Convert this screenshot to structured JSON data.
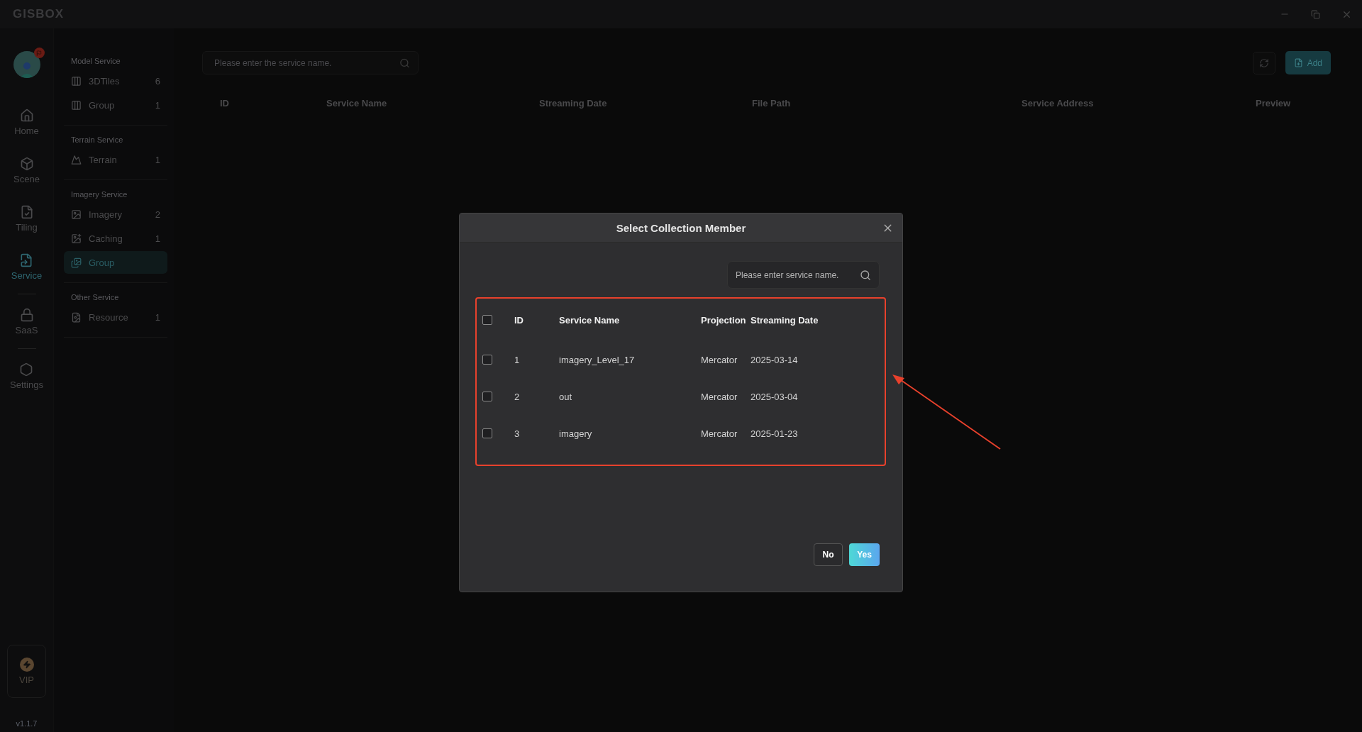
{
  "app": {
    "logo": "GISBOX"
  },
  "rail": {
    "items": [
      {
        "label": "Home",
        "selected": false
      },
      {
        "label": "Scene",
        "selected": false
      },
      {
        "label": "Tiling",
        "selected": false
      },
      {
        "label": "Service",
        "selected": true
      },
      {
        "label": "SaaS",
        "selected": false
      },
      {
        "label": "Settings",
        "selected": false
      }
    ],
    "vip": "VIP",
    "version": "v1.1.7"
  },
  "sidebar": {
    "sections": [
      {
        "title": "Model Service",
        "items": [
          {
            "label": "3DTiles",
            "count": "6",
            "selected": false
          },
          {
            "label": "Group",
            "count": "1",
            "selected": false
          }
        ]
      },
      {
        "title": "Terrain Service",
        "items": [
          {
            "label": "Terrain",
            "count": "1",
            "selected": false
          }
        ]
      },
      {
        "title": "Imagery Service",
        "items": [
          {
            "label": "Imagery",
            "count": "2",
            "selected": false
          },
          {
            "label": "Caching",
            "count": "1",
            "selected": false
          },
          {
            "label": "Group",
            "selected": true
          }
        ]
      },
      {
        "title": "Other Service",
        "items": [
          {
            "label": "Resource",
            "count": "1",
            "selected": false
          }
        ]
      }
    ]
  },
  "main": {
    "search": {
      "placeholder": "Please enter the service name."
    },
    "add_button": "Add",
    "columns": [
      "ID",
      "Service Name",
      "Streaming Date",
      "File Path",
      "Service Address",
      "Preview"
    ]
  },
  "dialog": {
    "title": "Select Collection Member",
    "search": {
      "placeholder": "Please enter service name."
    },
    "select_all_checked": false,
    "columns": [
      "ID",
      "Service Name",
      "Projection",
      "Streaming Date"
    ],
    "rows": [
      {
        "id": "1",
        "name": "imagery_Level_17",
        "projection": "Mercator",
        "date": "2025-03-14",
        "checked": false
      },
      {
        "id": "2",
        "name": "out",
        "projection": "Mercator",
        "date": "2025-03-04",
        "checked": false
      },
      {
        "id": "3",
        "name": "imagery",
        "projection": "Mercator",
        "date": "2025-01-23",
        "checked": false
      }
    ],
    "buttons": {
      "no": "No",
      "yes": "Yes"
    }
  }
}
